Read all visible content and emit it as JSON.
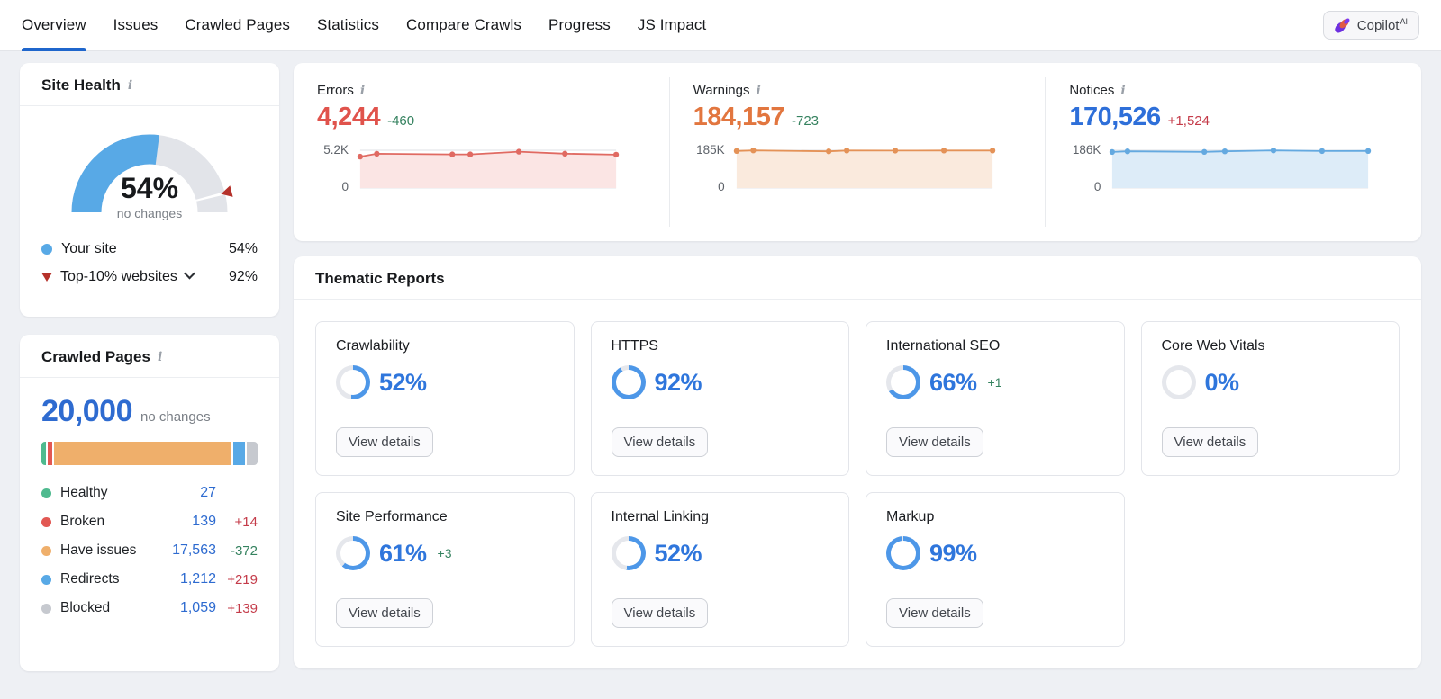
{
  "colors": {
    "accent_blue": "#2e6bd0",
    "active_tab_underline": "#1f66cc",
    "delta_green": "#35825f",
    "delta_red": "#c43b49",
    "errors_red": "#e0534c",
    "warnings_orange": "#e2763f",
    "notices_blue": "#2e6fd9"
  },
  "nav": {
    "tabs": [
      {
        "label": "Overview",
        "active": true
      },
      {
        "label": "Issues",
        "active": false
      },
      {
        "label": "Crawled Pages",
        "active": false
      },
      {
        "label": "Statistics",
        "active": false
      },
      {
        "label": "Compare Crawls",
        "active": false
      },
      {
        "label": "Progress",
        "active": false
      },
      {
        "label": "JS Impact",
        "active": false
      }
    ],
    "copilot_label": "Copilot",
    "copilot_sup": "AI"
  },
  "site_health": {
    "title": "Site Health",
    "value_label": "54%",
    "change_label": "no changes",
    "legend": [
      {
        "label": "Your site",
        "value": "54%"
      },
      {
        "label": "Top-10% websites",
        "value": "92%"
      }
    ]
  },
  "crawled_pages": {
    "title": "Crawled Pages",
    "total": "20,000",
    "change_label": "no changes",
    "rows": [
      {
        "label": "Healthy",
        "value": "27",
        "delta": "",
        "delta_color": ""
      },
      {
        "label": "Broken",
        "value": "139",
        "delta": "+14",
        "delta_color": "#c43b49"
      },
      {
        "label": "Have issues",
        "value": "17,563",
        "delta": "-372",
        "delta_color": "#35825f"
      },
      {
        "label": "Redirects",
        "value": "1,212",
        "delta": "+219",
        "delta_color": "#c43b49"
      },
      {
        "label": "Blocked",
        "value": "1,059",
        "delta": "+139",
        "delta_color": "#c43b49"
      }
    ]
  },
  "stats": [
    {
      "title": "Errors",
      "value": "4,244",
      "value_color": "#e0534c",
      "delta": "-460",
      "delta_color": "#35825f"
    },
    {
      "title": "Warnings",
      "value": "184,157",
      "value_color": "#e2763f",
      "delta": "-723",
      "delta_color": "#35825f"
    },
    {
      "title": "Notices",
      "value": "170,526",
      "value_color": "#2e6fd9",
      "delta": "+1,524",
      "delta_color": "#c43b49"
    }
  ],
  "thematic": {
    "title": "Thematic Reports",
    "button_label": "View details",
    "reports": [
      {
        "title": "Crawlability",
        "percent_label": "52%",
        "delta": "",
        "delta_color": ""
      },
      {
        "title": "HTTPS",
        "percent_label": "92%",
        "delta": "",
        "delta_color": ""
      },
      {
        "title": "International SEO",
        "percent_label": "66%",
        "delta": "+1",
        "delta_color": "#35825f"
      },
      {
        "title": "Core Web Vitals",
        "percent_label": "0%",
        "delta": "",
        "delta_color": ""
      },
      {
        "title": "Site Performance",
        "percent_label": "61%",
        "delta": "+3",
        "delta_color": "#35825f"
      },
      {
        "title": "Internal Linking",
        "percent_label": "52%",
        "delta": "",
        "delta_color": ""
      },
      {
        "title": "Markup",
        "percent_label": "99%",
        "delta": "",
        "delta_color": ""
      }
    ]
  },
  "chart_data": [
    {
      "type": "gauge",
      "title": "Site Health",
      "value": 54,
      "benchmark": 92,
      "unit": "%",
      "fill_color": "#58a9e6",
      "track_color": "#e2e4e9",
      "marker_color": "#b5312a"
    },
    {
      "type": "area",
      "title": "Errors",
      "ymax": 5200,
      "ymax_label": "5.2K",
      "ymin_label": "0",
      "x": [
        0,
        0.065,
        0.36,
        0.43,
        0.62,
        0.8,
        1
      ],
      "values": [
        4320,
        4720,
        4630,
        4630,
        5000,
        4730,
        4590
      ],
      "line_color": "#e06a62",
      "fill_color": "#fbe5e4"
    },
    {
      "type": "area",
      "title": "Warnings",
      "ymax": 185000,
      "ymax_label": "185K",
      "ymin_label": "0",
      "x": [
        0,
        0.065,
        0.36,
        0.43,
        0.62,
        0.81,
        1
      ],
      "values": [
        181500,
        184000,
        179500,
        183800,
        183300,
        183800,
        183800
      ],
      "line_color": "#e49257",
      "fill_color": "#faeadd"
    },
    {
      "type": "area",
      "title": "Notices",
      "ymax": 186000,
      "ymax_label": "186K",
      "ymin_label": "0",
      "x": [
        0,
        0.06,
        0.36,
        0.44,
        0.63,
        0.82,
        1
      ],
      "values": [
        177500,
        180600,
        178200,
        180800,
        185300,
        182000,
        182300
      ],
      "line_color": "#64a9e0",
      "fill_color": "#ddecf8"
    },
    {
      "type": "stacked-bar",
      "title": "Crawled Pages",
      "total": 20000,
      "segments": [
        {
          "label": "Healthy",
          "value": 27,
          "color": "#4fba8f"
        },
        {
          "label": "Broken",
          "value": 139,
          "color": "#e25853"
        },
        {
          "label": "Have issues",
          "value": 17563,
          "color": "#efaf6b"
        },
        {
          "label": "Redirects",
          "value": 1212,
          "color": "#58a9e6"
        },
        {
          "label": "Blocked",
          "value": 1059,
          "color": "#c6c9cf"
        }
      ]
    },
    {
      "type": "donut-set",
      "title": "Thematic Reports",
      "ring_color": "#4d97e8",
      "track_color": "#e5e7ec",
      "percents": [
        52,
        92,
        66,
        0,
        61,
        52,
        99
      ]
    }
  ]
}
